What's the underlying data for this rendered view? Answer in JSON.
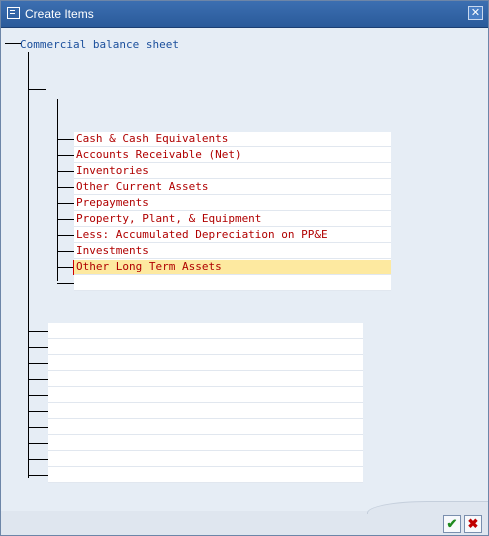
{
  "window": {
    "title": "Create Items",
    "close_icon": "close-icon"
  },
  "tree": {
    "root_label": "Commercial balance sheet",
    "items": [
      "Cash & Cash Equivalents",
      "Accounts Receivable (Net)",
      "Inventories",
      "Other Current Assets",
      "Prepayments",
      "Property, Plant, & Equipment",
      "Less: Accumulated Depreciation on PP&E",
      "Investments",
      "Other Long Term Assets"
    ],
    "selected_item": "Other Long Term Assets",
    "empty_rows_group1": 1,
    "empty_rows_group2": 10
  },
  "footer": {
    "ok_icon": "checkmark-icon",
    "cancel_icon": "cancel-x-icon"
  },
  "colors": {
    "title_bar": "#2f64a8",
    "item_text": "#b00000",
    "root_text": "#1b4f9c",
    "selection": "#fde9a0"
  }
}
